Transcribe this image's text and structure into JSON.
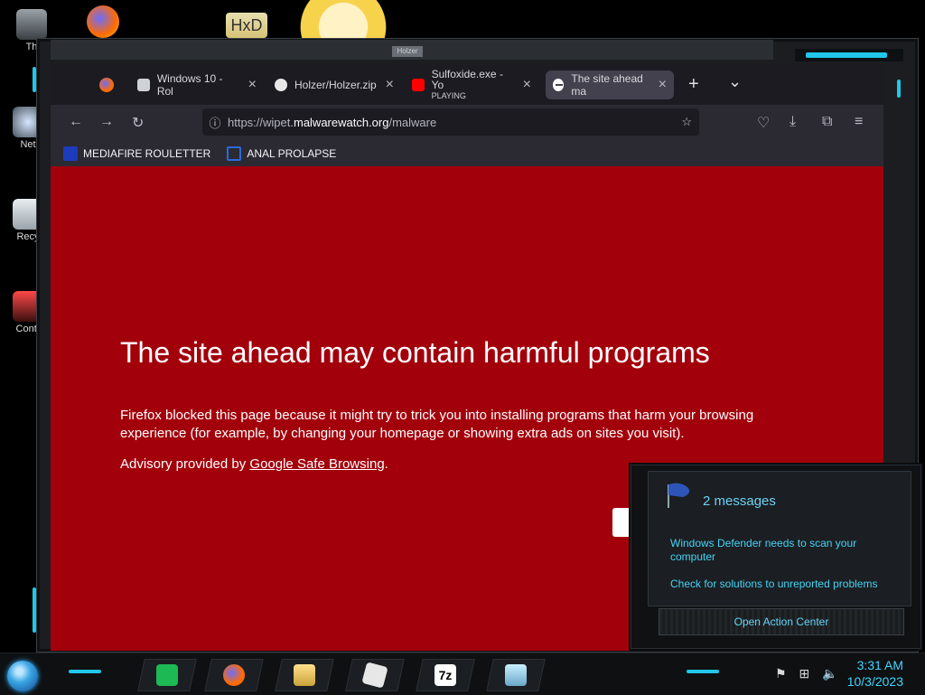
{
  "desktop": {
    "icons": [
      {
        "label": "Th"
      },
      {
        "label": "Net"
      },
      {
        "label": "Recy"
      },
      {
        "label": "Contr"
      }
    ],
    "frame_title": "Holzer"
  },
  "browser": {
    "tabs": [
      {
        "label": "Windows 10 - Rol",
        "close": "×",
        "active": false
      },
      {
        "label": "Holzer/Holzer.zip",
        "close": "×",
        "active": false
      },
      {
        "label": "Sulfoxide.exe - Yo",
        "sublabel": "PLAYING",
        "close": "×",
        "active": false
      },
      {
        "label": "The site ahead ma",
        "close": "×",
        "active": true
      }
    ],
    "new_tab_symbol": "+",
    "tab_list_symbol": "⌄",
    "url": {
      "prefix": "https://wipet.",
      "domain": "malwarewatch.org",
      "path": "/malware"
    },
    "bookmarks": [
      {
        "label": "MEDIAFIRE ROULETTER"
      },
      {
        "label": "ANAL PROLAPSE"
      }
    ]
  },
  "warning": {
    "title": "The site ahead may contain harmful programs",
    "body": "Firefox blocked this page because it might try to trick you into installing programs that harm your browsing experience (for example, by changing your homepage or showing extra ads on sites you visit).",
    "advisory_prefix": "Advisory provided by ",
    "advisory_link": "Google Safe Browsing",
    "advisory_suffix": "."
  },
  "notification": {
    "title": "2 messages",
    "messages": [
      "Windows Defender needs to scan your computer",
      "Check for solutions to unreported problems"
    ],
    "action": "Open Action Center"
  },
  "taskbar": {
    "time": "3:31 AM",
    "date": "10/3/2023",
    "items": [
      {
        "name": "spotify"
      },
      {
        "name": "firefox"
      },
      {
        "name": "file-explorer"
      },
      {
        "name": "roblox"
      },
      {
        "name": "7zip",
        "label": "7z"
      },
      {
        "name": "notepad"
      }
    ]
  },
  "colors": {
    "warning_bg": "#a2000b",
    "accent_cyan": "#20c7e9",
    "browser_bg": "#1c1b22"
  }
}
